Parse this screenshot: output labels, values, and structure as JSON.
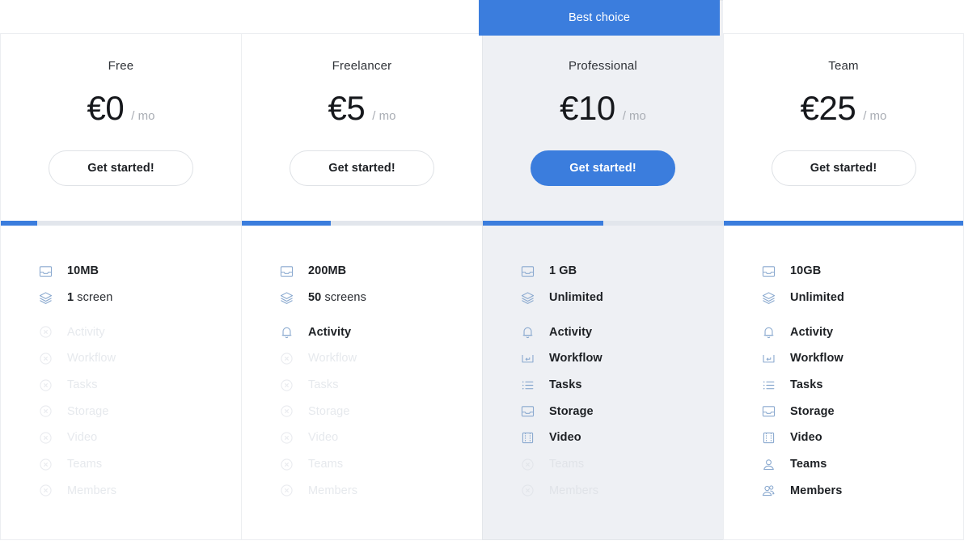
{
  "ribbon": {
    "label": "Best choice"
  },
  "colors": {
    "accent": "#3b7ddd",
    "featured_bg": "#eef0f4",
    "meter_track": "#e2e6ec",
    "icon": "#8aa9cf",
    "text": "#1d2024",
    "muted": "#a9adb4",
    "disabled": "#e6e9ed",
    "border": "#eceef1"
  },
  "feature_rows": [
    "storage-quota",
    "screens",
    "activity",
    "workflow",
    "tasks",
    "storage",
    "video",
    "teams",
    "members"
  ],
  "plans": [
    {
      "name": "Free",
      "price": "€0",
      "period": "/ mo",
      "cta": "Get started!",
      "featured": false,
      "best_choice": false,
      "meter_percent": 15,
      "features": [
        {
          "icon": "inbox-icon",
          "label": "10MB",
          "strong": "10MB",
          "rest": "",
          "enabled": true
        },
        {
          "icon": "layers-icon",
          "label": "1 screen",
          "strong": "1",
          "rest": " screen",
          "enabled": true
        },
        {
          "icon": "bell-icon",
          "label": "Activity",
          "strong": "Activity",
          "rest": "",
          "enabled": false
        },
        {
          "icon": "workflow-icon",
          "label": "Workflow",
          "strong": "Workflow",
          "rest": "",
          "enabled": false
        },
        {
          "icon": "list-icon",
          "label": "Tasks",
          "strong": "Tasks",
          "rest": "",
          "enabled": false
        },
        {
          "icon": "inbox-icon",
          "label": "Storage",
          "strong": "Storage",
          "rest": "",
          "enabled": false
        },
        {
          "icon": "film-icon",
          "label": "Video",
          "strong": "Video",
          "rest": "",
          "enabled": false
        },
        {
          "icon": "person-icon",
          "label": "Teams",
          "strong": "Teams",
          "rest": "",
          "enabled": false
        },
        {
          "icon": "people-icon",
          "label": "Members",
          "strong": "Members",
          "rest": "",
          "enabled": false
        }
      ]
    },
    {
      "name": "Freelancer",
      "price": "€5",
      "period": "/ mo",
      "cta": "Get started!",
      "featured": false,
      "best_choice": false,
      "meter_percent": 37,
      "features": [
        {
          "icon": "inbox-icon",
          "label": "200MB",
          "strong": "200MB",
          "rest": "",
          "enabled": true
        },
        {
          "icon": "layers-icon",
          "label": "50 screens",
          "strong": "50",
          "rest": " screens",
          "enabled": true
        },
        {
          "icon": "bell-icon",
          "label": "Activity",
          "strong": "Activity",
          "rest": "",
          "enabled": true
        },
        {
          "icon": "workflow-icon",
          "label": "Workflow",
          "strong": "Workflow",
          "rest": "",
          "enabled": false
        },
        {
          "icon": "list-icon",
          "label": "Tasks",
          "strong": "Tasks",
          "rest": "",
          "enabled": false
        },
        {
          "icon": "inbox-icon",
          "label": "Storage",
          "strong": "Storage",
          "rest": "",
          "enabled": false
        },
        {
          "icon": "film-icon",
          "label": "Video",
          "strong": "Video",
          "rest": "",
          "enabled": false
        },
        {
          "icon": "person-icon",
          "label": "Teams",
          "strong": "Teams",
          "rest": "",
          "enabled": false
        },
        {
          "icon": "people-icon",
          "label": "Members",
          "strong": "Members",
          "rest": "",
          "enabled": false
        }
      ]
    },
    {
      "name": "Professional",
      "price": "€10",
      "period": "/ mo",
      "cta": "Get started!",
      "featured": true,
      "best_choice": true,
      "meter_percent": 50,
      "features": [
        {
          "icon": "inbox-icon",
          "label": "1 GB",
          "strong": "1 GB",
          "rest": "",
          "enabled": true
        },
        {
          "icon": "layers-icon",
          "label": "Unlimited",
          "strong": "Unlimited",
          "rest": "",
          "enabled": true
        },
        {
          "icon": "bell-icon",
          "label": "Activity",
          "strong": "Activity",
          "rest": "",
          "enabled": true
        },
        {
          "icon": "workflow-icon",
          "label": "Workflow",
          "strong": "Workflow",
          "rest": "",
          "enabled": true
        },
        {
          "icon": "list-icon",
          "label": "Tasks",
          "strong": "Tasks",
          "rest": "",
          "enabled": true
        },
        {
          "icon": "inbox-icon",
          "label": "Storage",
          "strong": "Storage",
          "rest": "",
          "enabled": true
        },
        {
          "icon": "film-icon",
          "label": "Video",
          "strong": "Video",
          "rest": "",
          "enabled": true
        },
        {
          "icon": "person-icon",
          "label": "Teams",
          "strong": "Teams",
          "rest": "",
          "enabled": false
        },
        {
          "icon": "people-icon",
          "label": "Members",
          "strong": "Members",
          "rest": "",
          "enabled": false
        }
      ]
    },
    {
      "name": "Team",
      "price": "€25",
      "period": "/ mo",
      "cta": "Get started!",
      "featured": false,
      "best_choice": false,
      "meter_percent": 100,
      "features": [
        {
          "icon": "inbox-icon",
          "label": "10GB",
          "strong": "10GB",
          "rest": "",
          "enabled": true
        },
        {
          "icon": "layers-icon",
          "label": "Unlimited",
          "strong": "Unlimited",
          "rest": "",
          "enabled": true
        },
        {
          "icon": "bell-icon",
          "label": "Activity",
          "strong": "Activity",
          "rest": "",
          "enabled": true
        },
        {
          "icon": "workflow-icon",
          "label": "Workflow",
          "strong": "Workflow",
          "rest": "",
          "enabled": true
        },
        {
          "icon": "list-icon",
          "label": "Tasks",
          "strong": "Tasks",
          "rest": "",
          "enabled": true
        },
        {
          "icon": "inbox-icon",
          "label": "Storage",
          "strong": "Storage",
          "rest": "",
          "enabled": true
        },
        {
          "icon": "film-icon",
          "label": "Video",
          "strong": "Video",
          "rest": "",
          "enabled": true
        },
        {
          "icon": "person-icon",
          "label": "Teams",
          "strong": "Teams",
          "rest": "",
          "enabled": true
        },
        {
          "icon": "people-icon",
          "label": "Members",
          "strong": "Members",
          "rest": "",
          "enabled": true
        }
      ]
    }
  ]
}
